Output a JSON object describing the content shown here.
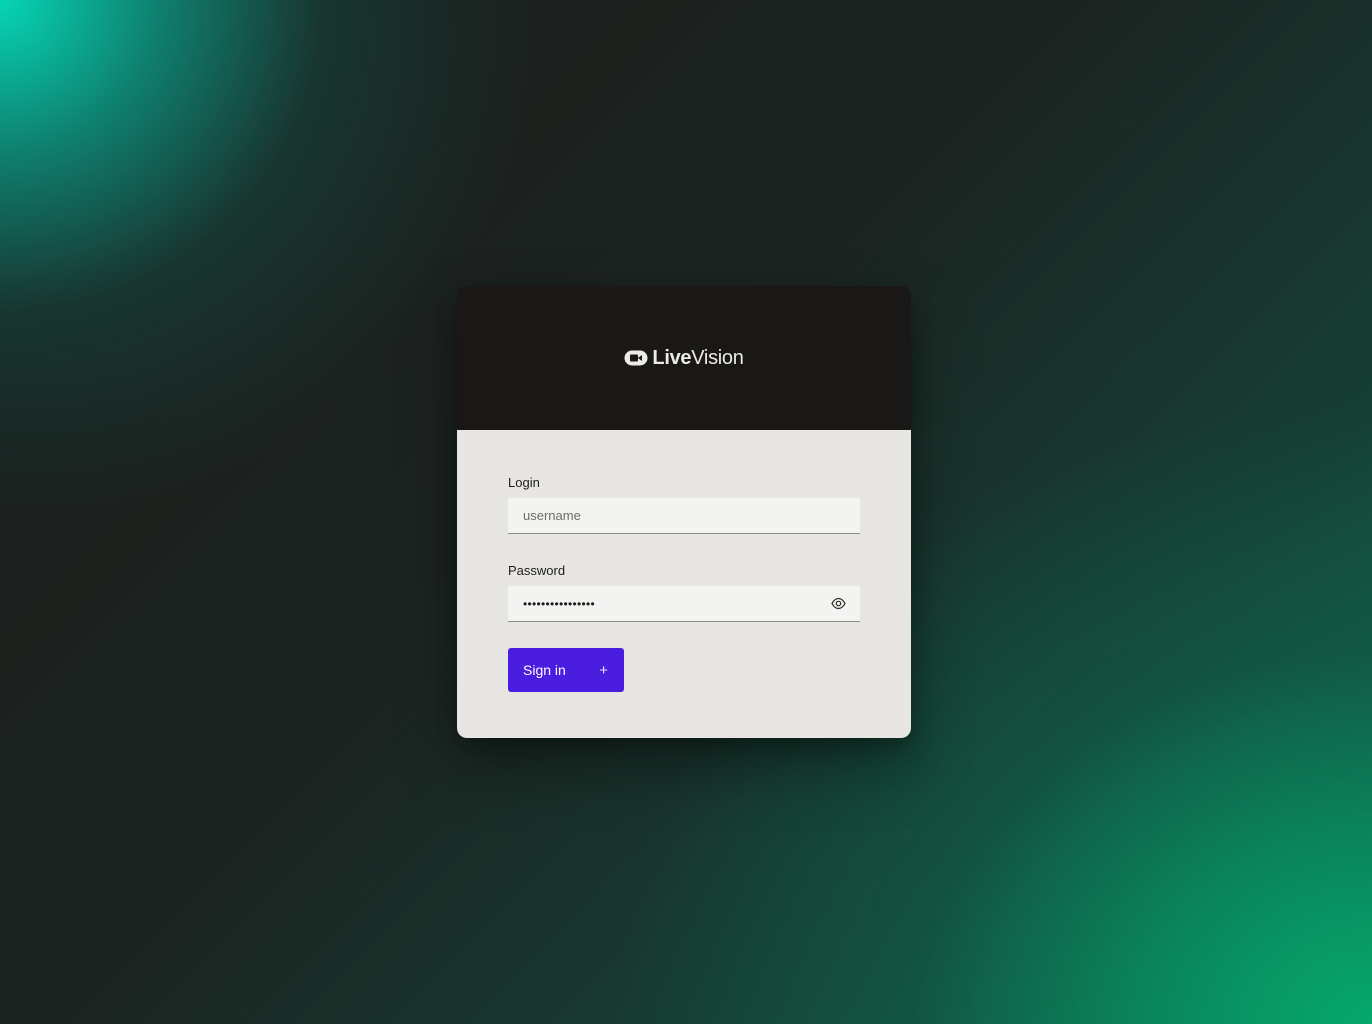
{
  "brand": {
    "name_bold": "Live",
    "name_light": "Vision",
    "logo_icon": "video-camera-icon"
  },
  "login_form": {
    "login_label": "Login",
    "login_placeholder": "username",
    "login_value": "",
    "password_label": "Password",
    "password_masked": "••••••••••••••••",
    "show_password_icon": "eye-icon",
    "submit_label": "Sign in",
    "submit_icon": "plus-icon"
  },
  "colors": {
    "primary_button": "#4a1de0",
    "card_header": "#1a1817",
    "card_body": "#e8e6e2",
    "input_background": "#f3f3f2",
    "gradient_teal": "#06d6b6",
    "gradient_green": "#06a86e"
  }
}
